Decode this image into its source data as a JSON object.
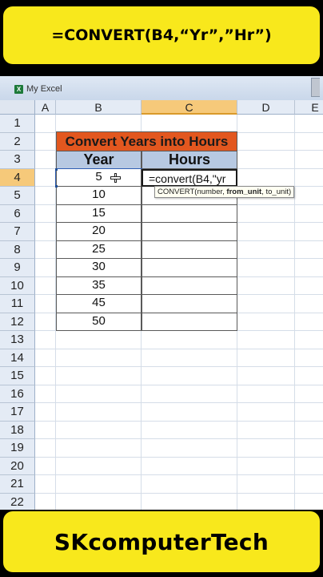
{
  "top_banner": {
    "text": "=CONVERT(B4,“Yr”,”Hr”)"
  },
  "bottom_banner": {
    "text": "SKcomputerTech"
  },
  "window": {
    "title": "My Excel",
    "icon": "excel-icon"
  },
  "columns": [
    "A",
    "B",
    "C",
    "D",
    "E"
  ],
  "selected_column": "C",
  "rows": [
    "1",
    "2",
    "3",
    "4",
    "5",
    "6",
    "7",
    "8",
    "9",
    "10",
    "11",
    "12",
    "13",
    "14",
    "15",
    "16",
    "17",
    "18",
    "19",
    "20",
    "21",
    "22"
  ],
  "selected_row": "4",
  "table": {
    "title": "Convert Years into Hours",
    "headers": {
      "year": "Year",
      "hours": "Hours"
    },
    "years": [
      "5",
      "10",
      "15",
      "20",
      "25",
      "30",
      "35",
      "45",
      "50"
    ]
  },
  "editing": {
    "formula": "=convert(B4,\"yr",
    "tooltip_prefix": "CONVERT(number, ",
    "tooltip_bold": "from_unit",
    "tooltip_suffix": ", to_unit)"
  },
  "colors": {
    "banner": "#f8e81c",
    "title_fill": "#e2571f",
    "header_fill": "#b7c9e2",
    "selection": "#f6c97a"
  }
}
